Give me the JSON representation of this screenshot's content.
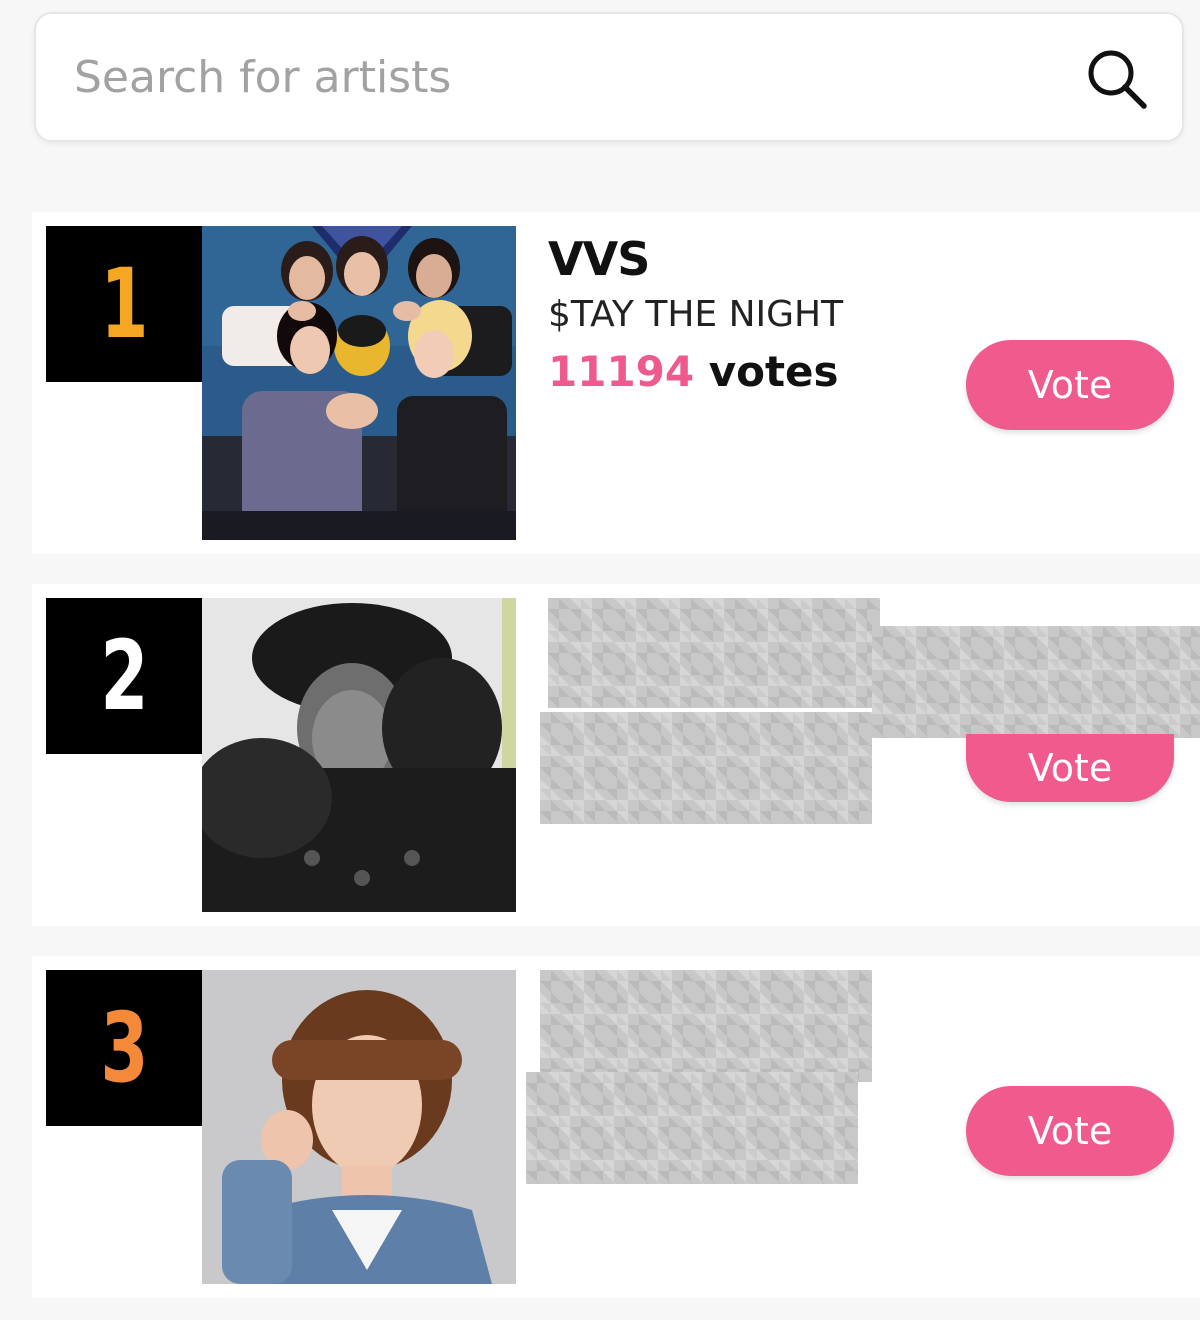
{
  "search": {
    "placeholder": "Search for artists",
    "icon": "search-icon"
  },
  "ranking": [
    {
      "rank": "1",
      "rank_color": "#f5a623",
      "artist": "VVS",
      "song": "$TAY THE NIGHT",
      "votes": "11194",
      "votes_suffix": " votes",
      "vote_label": "Vote"
    },
    {
      "rank": "2",
      "rank_color": "#ffffff",
      "vote_label": "Vote"
    },
    {
      "rank": "3",
      "rank_color": "#f5893a",
      "vote_label": "Vote"
    }
  ],
  "colors": {
    "accent": "#f05a8c",
    "vote_count": "#ef5a8c",
    "badge_bg": "#000000"
  }
}
